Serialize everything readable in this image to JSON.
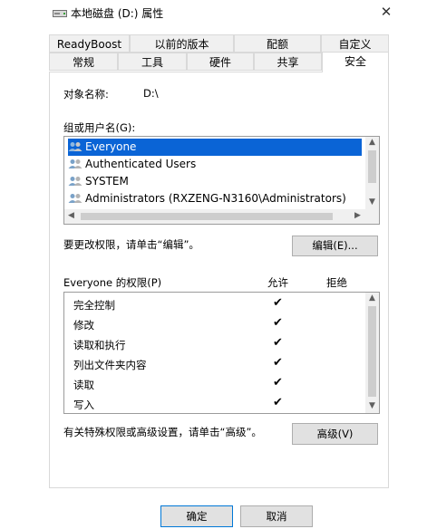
{
  "window": {
    "title": "本地磁盘 (D:) 属性",
    "close": "✕"
  },
  "tabs_back": [
    "ReadyBoost",
    "以前的版本",
    "配额",
    "自定义"
  ],
  "tabs_front": [
    "常规",
    "工具",
    "硬件",
    "共享",
    "安全"
  ],
  "object": {
    "label": "对象名称:",
    "value": "D:\\"
  },
  "groups": {
    "label": "组或用户名(G):",
    "items": [
      "Everyone",
      "Authenticated Users",
      "SYSTEM",
      "Administrators (RXZENG-N3160\\Administrators)"
    ]
  },
  "edit": {
    "hint": "要更改权限，请单击“编辑”。",
    "button": "编辑(E)..."
  },
  "perms": {
    "label": "Everyone 的权限(P)",
    "allow": "允许",
    "deny": "拒绝",
    "rows": [
      {
        "name": "完全控制",
        "allow": "✔",
        "deny": ""
      },
      {
        "name": "修改",
        "allow": "✔",
        "deny": ""
      },
      {
        "name": "读取和执行",
        "allow": "✔",
        "deny": ""
      },
      {
        "name": "列出文件夹内容",
        "allow": "✔",
        "deny": ""
      },
      {
        "name": "读取",
        "allow": "✔",
        "deny": ""
      },
      {
        "name": "写入",
        "allow": "✔",
        "deny": ""
      }
    ]
  },
  "advanced": {
    "hint": "有关特殊权限或高级设置，请单击“高级”。",
    "button": "高级(V)"
  },
  "footer": {
    "ok": "确定",
    "cancel": "取消"
  },
  "scroll": {
    "up": "▲",
    "down": "▼",
    "left": "◀",
    "right": "▶"
  },
  "colors": {
    "selection": "#0a64d6",
    "panel_border": "#d9d9d9",
    "button_bg": "#e1e1e1"
  }
}
